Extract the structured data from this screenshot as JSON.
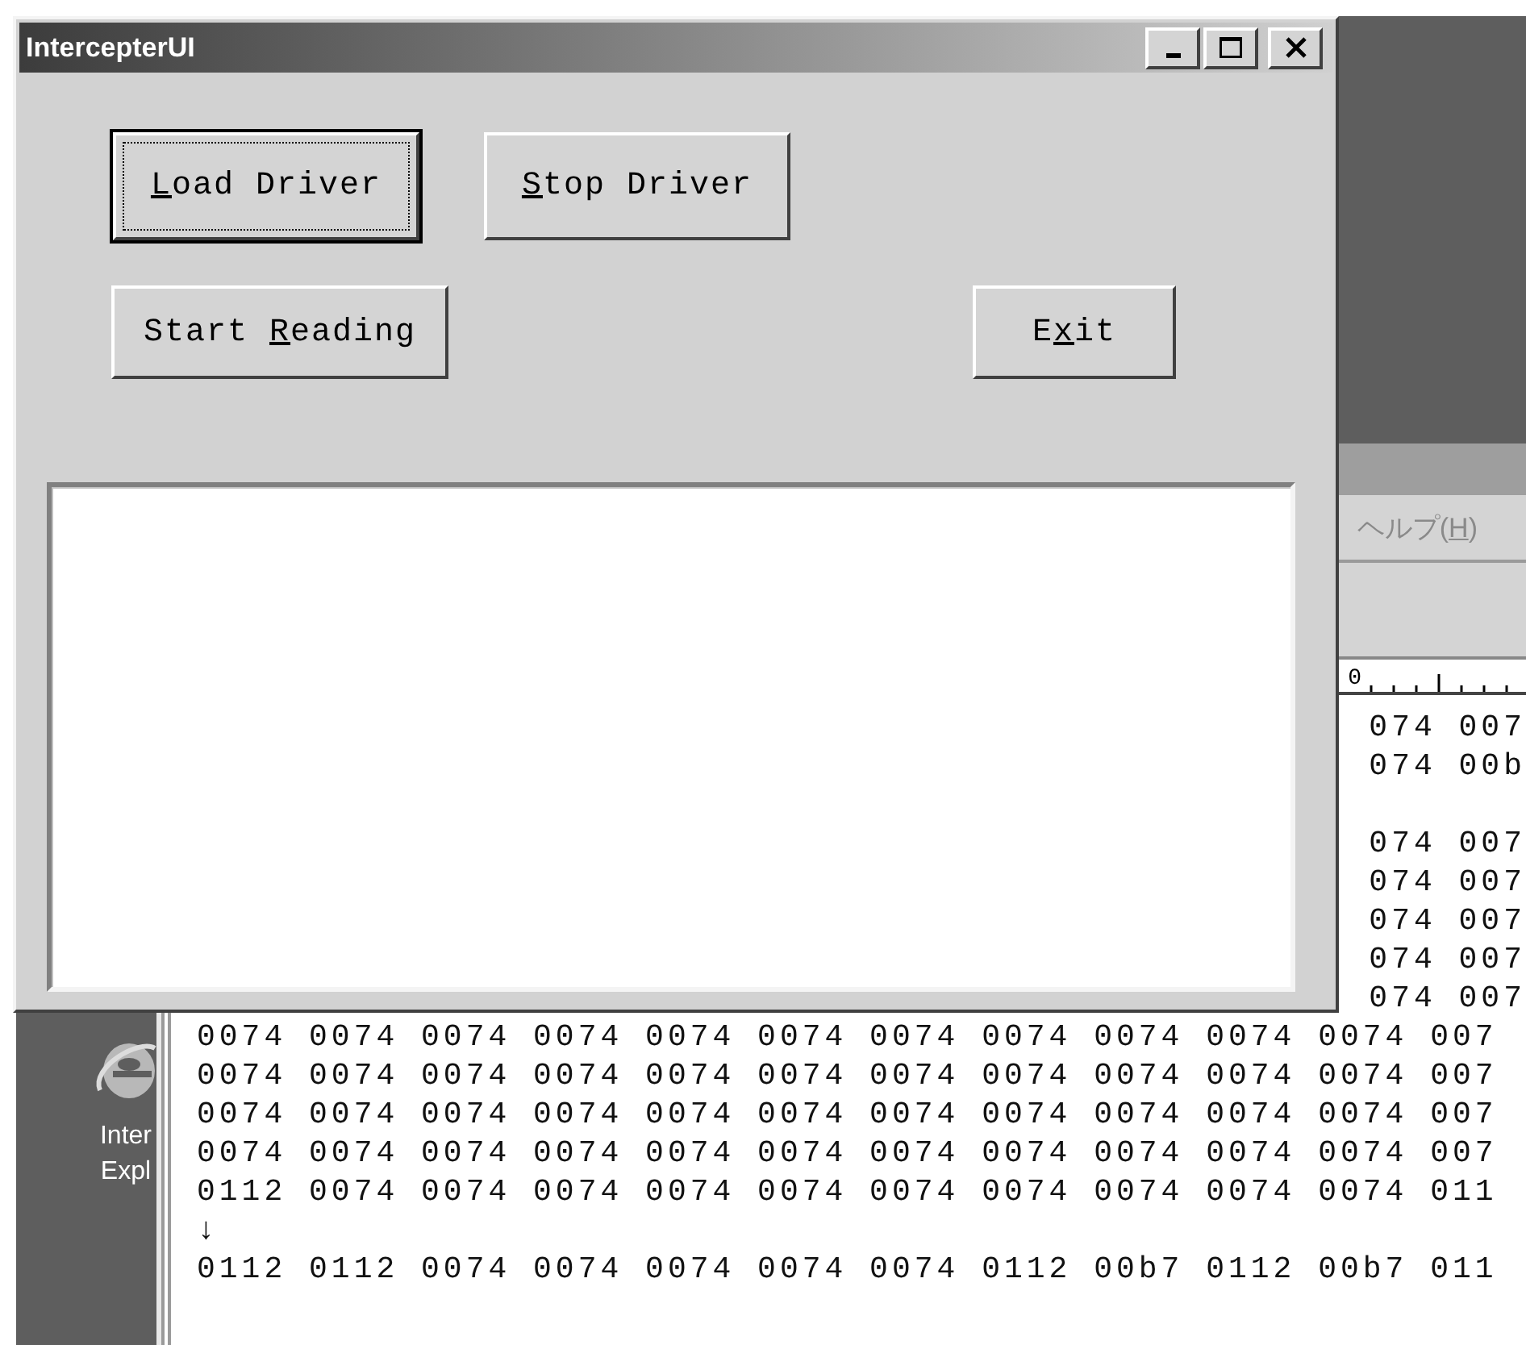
{
  "dialog": {
    "title": "IntercepterUI",
    "title_buttons": [
      {
        "kind": "minimize"
      },
      {
        "kind": "maximize"
      },
      {
        "kind": "close"
      }
    ],
    "button_rows": [
      {
        "buttons": [
          {
            "access_key": "L",
            "label_rest": "oad Driver",
            "default": true
          },
          {
            "access_key": "S",
            "label_rest": "top Driver",
            "default": false
          }
        ]
      },
      {
        "buttons": [
          {
            "label_start": "Start ",
            "access_key": "R",
            "label_rest": "eading",
            "default": false
          },
          {
            "label_start": "E",
            "access_key": "x",
            "label_rest": "it",
            "default": false
          }
        ]
      }
    ]
  },
  "editor": {
    "menu": [
      {
        "label_start": "ヘルプ(",
        "access_key": "H",
        "label_rest": ")"
      }
    ],
    "ruler": {
      "label": "0"
    },
    "lines": [
      {
        "kind": "partial",
        "text": "074 007"
      },
      {
        "kind": "partial",
        "text": "074 00b"
      },
      {
        "kind": "blank"
      },
      {
        "kind": "partial",
        "text": "074 007"
      },
      {
        "kind": "partial",
        "text": "074 007"
      },
      {
        "kind": "partial",
        "text": "074 007"
      },
      {
        "kind": "partial",
        "text": "074 007"
      },
      {
        "kind": "partial",
        "text": "074 007"
      },
      {
        "kind": "full",
        "text": "0074 0074 0074 0074 0074 0074 0074 0074 0074 0074 0074 007"
      },
      {
        "kind": "full",
        "text": "0074 0074 0074 0074 0074 0074 0074 0074 0074 0074 0074 007"
      },
      {
        "kind": "full",
        "text": "0074 0074 0074 0074 0074 0074 0074 0074 0074 0074 0074 007"
      },
      {
        "kind": "full",
        "text": "0074 0074 0074 0074 0074 0074 0074 0074 0074 0074 0074 007"
      },
      {
        "kind": "full",
        "text": "0112 0074 0074 0074 0074 0074 0074 0074 0074 0074 0074 011"
      },
      {
        "kind": "full",
        "text": "↓"
      },
      {
        "kind": "full",
        "text": "0112 0112 0074 0074 0074 0074 0074 0112 00b7 0112 00b7 011"
      }
    ]
  },
  "desktop_icons": [
    {
      "label_lines": [
        "Inter",
        "Expl"
      ]
    }
  ]
}
